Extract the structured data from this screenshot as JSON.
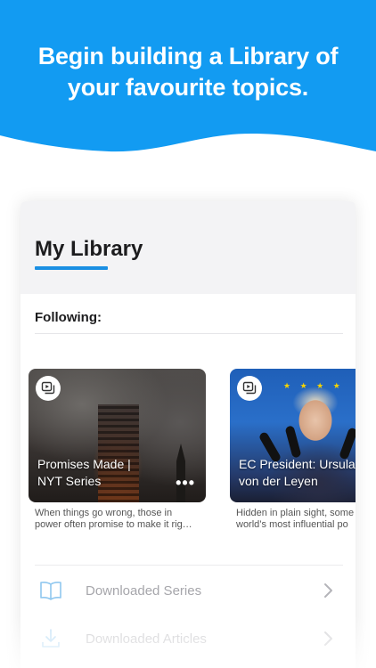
{
  "headline": "Begin building a Library of\nyour favourite topics.",
  "colors": {
    "hero_blue": "#129bf2",
    "accent": "#1a8fe3",
    "card_header_bg": "#f3f3f5"
  },
  "library": {
    "title": "My Library",
    "following_label": "Following:"
  },
  "series": [
    {
      "title": "Promises Made |\nNYT Series",
      "description": "When things go wrong, those in\npower often promise to make it rig…",
      "badge_icon": "play-stack-icon",
      "menu_icon": "more-dots-icon"
    },
    {
      "title": "EC President: Ursula\nvon der Leyen",
      "description": "Hidden in plain sight, some\nworld’s most influential po",
      "badge_icon": "play-stack-icon"
    }
  ],
  "menu": [
    {
      "label": "Downloaded Series",
      "icon": "book-icon"
    },
    {
      "label": "Downloaded Articles",
      "icon": "download-icon"
    }
  ]
}
